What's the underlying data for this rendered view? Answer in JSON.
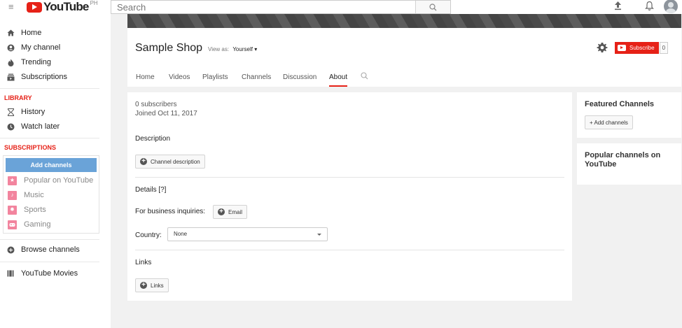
{
  "topbar": {
    "logo_text": "YouTube",
    "logo_country": "PH",
    "search_placeholder": "Search"
  },
  "sidebar": {
    "items": [
      {
        "label": "Home",
        "icon": "home-icon"
      },
      {
        "label": "My channel",
        "icon": "person-icon"
      },
      {
        "label": "Trending",
        "icon": "flame-icon"
      },
      {
        "label": "Subscriptions",
        "icon": "subscriptions-icon"
      }
    ],
    "library_heading": "LIBRARY",
    "library_items": [
      {
        "label": "History",
        "icon": "hourglass-icon"
      },
      {
        "label": "Watch later",
        "icon": "clock-icon"
      }
    ],
    "subscriptions_heading": "SUBSCRIPTIONS",
    "add_channels_label": "Add channels",
    "subscription_items": [
      {
        "label": "Popular on YouTube",
        "icon": "star-icon"
      },
      {
        "label": "Music",
        "icon": "music-icon"
      },
      {
        "label": "Sports",
        "icon": "ball-icon"
      },
      {
        "label": "Gaming",
        "icon": "gamepad-icon"
      }
    ],
    "browse_channels_label": "Browse channels",
    "youtube_movies_label": "YouTube Movies"
  },
  "channel": {
    "title": "Sample Shop",
    "view_as_label": "View as:",
    "view_as_value": "Yourself",
    "subscribe_label": "Subscribe",
    "subscriber_count": "0",
    "tabs": [
      "Home",
      "Videos",
      "Playlists",
      "Channels",
      "Discussion",
      "About"
    ],
    "active_tab": "About"
  },
  "about": {
    "subscribers_text": "0 subscribers",
    "joined_text": "Joined Oct 11, 2017",
    "description_heading": "Description",
    "channel_description_button": "Channel description",
    "details_heading": "Details [?]",
    "business_label": "For business inquiries:",
    "email_button": "Email",
    "country_label": "Country:",
    "country_value": "None",
    "links_heading": "Links",
    "links_button": "Links"
  },
  "featured": {
    "title": "Featured Channels",
    "add_button": "+ Add channels"
  },
  "popular": {
    "title": "Popular channels on YouTube"
  },
  "colors": {
    "brand_red": "#e62117",
    "add_channels_blue": "#6aa3d8",
    "subscription_pink": "#f2849e"
  }
}
